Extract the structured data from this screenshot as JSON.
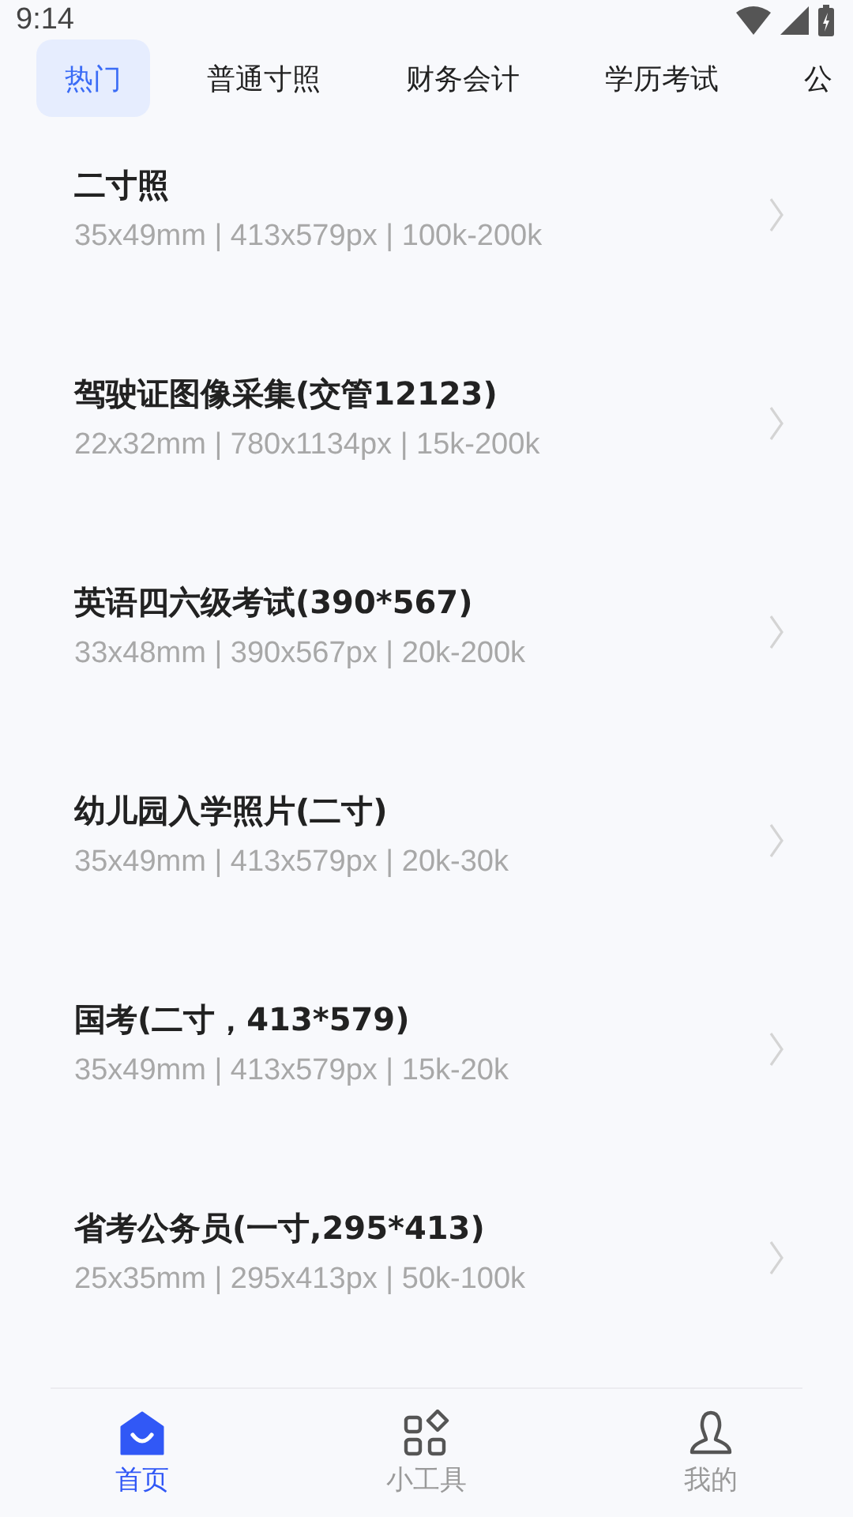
{
  "status_bar": {
    "time": "9:14"
  },
  "tabs": [
    {
      "label": "热门",
      "selected": true
    },
    {
      "label": "普通寸照",
      "selected": false
    },
    {
      "label": "财务会计",
      "selected": false
    },
    {
      "label": "学历考试",
      "selected": false
    },
    {
      "label": "公",
      "selected": false
    }
  ],
  "items": [
    {
      "title": "二寸照",
      "specs": "35x49mm | 413x579px | 100k-200k"
    },
    {
      "title": "驾驶证图像采集(交管12123)",
      "specs": "22x32mm | 780x1134px | 15k-200k"
    },
    {
      "title": "英语四六级考试(390*567)",
      "specs": "33x48mm | 390x567px | 20k-200k"
    },
    {
      "title": "幼儿园入学照片(二寸)",
      "specs": "35x49mm | 413x579px | 20k-30k"
    },
    {
      "title": "国考(二寸，413*579)",
      "specs": "35x49mm | 413x579px | 15k-20k"
    },
    {
      "title": "省考公务员(一寸,295*413)",
      "specs": "25x35mm | 295x413px | 50k-100k"
    }
  ],
  "bottom_nav": [
    {
      "kind": "home",
      "label": "首页",
      "selected": true
    },
    {
      "kind": "tools",
      "label": "小工具",
      "selected": false
    },
    {
      "kind": "profile",
      "label": "我的",
      "selected": false
    }
  ]
}
